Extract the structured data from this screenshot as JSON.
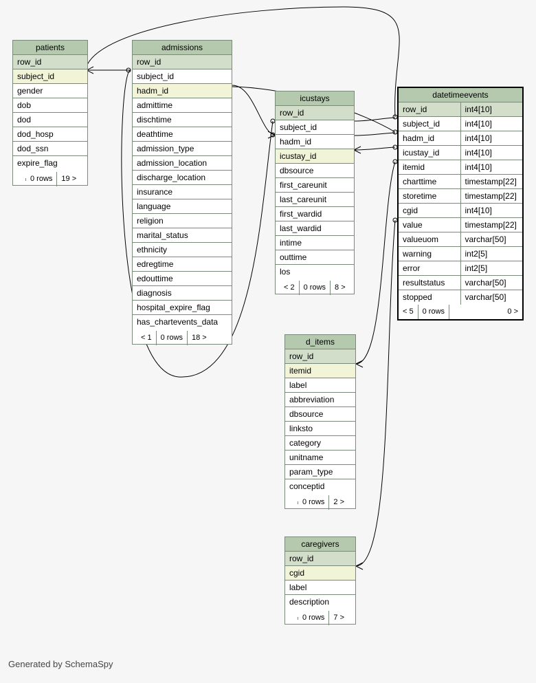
{
  "credit": "Generated by SchemaSpy",
  "tables": {
    "patients": {
      "title": "patients",
      "cols": [
        {
          "name": "row_id",
          "role": "pk"
        },
        {
          "name": "subject_id",
          "role": "fk"
        },
        {
          "name": "gender",
          "role": ""
        },
        {
          "name": "dob",
          "role": ""
        },
        {
          "name": "dod",
          "role": ""
        },
        {
          "name": "dod_hosp",
          "role": ""
        },
        {
          "name": "dod_ssn",
          "role": ""
        },
        {
          "name": "expire_flag",
          "role": ""
        }
      ],
      "footer": [
        "",
        "0 rows",
        "19 >"
      ]
    },
    "admissions": {
      "title": "admissions",
      "cols": [
        {
          "name": "row_id",
          "role": "pk"
        },
        {
          "name": "subject_id",
          "role": ""
        },
        {
          "name": "hadm_id",
          "role": "fk"
        },
        {
          "name": "admittime",
          "role": ""
        },
        {
          "name": "dischtime",
          "role": ""
        },
        {
          "name": "deathtime",
          "role": ""
        },
        {
          "name": "admission_type",
          "role": ""
        },
        {
          "name": "admission_location",
          "role": ""
        },
        {
          "name": "discharge_location",
          "role": ""
        },
        {
          "name": "insurance",
          "role": ""
        },
        {
          "name": "language",
          "role": ""
        },
        {
          "name": "religion",
          "role": ""
        },
        {
          "name": "marital_status",
          "role": ""
        },
        {
          "name": "ethnicity",
          "role": ""
        },
        {
          "name": "edregtime",
          "role": ""
        },
        {
          "name": "edouttime",
          "role": ""
        },
        {
          "name": "diagnosis",
          "role": ""
        },
        {
          "name": "hospital_expire_flag",
          "role": ""
        },
        {
          "name": "has_chartevents_data",
          "role": ""
        }
      ],
      "footer": [
        "< 1",
        "0 rows",
        "18 >"
      ]
    },
    "icustays": {
      "title": "icustays",
      "cols": [
        {
          "name": "row_id",
          "role": "pk"
        },
        {
          "name": "subject_id",
          "role": ""
        },
        {
          "name": "hadm_id",
          "role": ""
        },
        {
          "name": "icustay_id",
          "role": "fk"
        },
        {
          "name": "dbsource",
          "role": ""
        },
        {
          "name": "first_careunit",
          "role": ""
        },
        {
          "name": "last_careunit",
          "role": ""
        },
        {
          "name": "first_wardid",
          "role": ""
        },
        {
          "name": "last_wardid",
          "role": ""
        },
        {
          "name": "intime",
          "role": ""
        },
        {
          "name": "outtime",
          "role": ""
        },
        {
          "name": "los",
          "role": ""
        }
      ],
      "footer": [
        "< 2",
        "0 rows",
        "8 >"
      ]
    },
    "d_items": {
      "title": "d_items",
      "cols": [
        {
          "name": "row_id",
          "role": "pk"
        },
        {
          "name": "itemid",
          "role": "fk"
        },
        {
          "name": "label",
          "role": ""
        },
        {
          "name": "abbreviation",
          "role": ""
        },
        {
          "name": "dbsource",
          "role": ""
        },
        {
          "name": "linksto",
          "role": ""
        },
        {
          "name": "category",
          "role": ""
        },
        {
          "name": "unitname",
          "role": ""
        },
        {
          "name": "param_type",
          "role": ""
        },
        {
          "name": "conceptid",
          "role": ""
        }
      ],
      "footer": [
        "",
        "0 rows",
        "2 >"
      ]
    },
    "caregivers": {
      "title": "caregivers",
      "cols": [
        {
          "name": "row_id",
          "role": "pk"
        },
        {
          "name": "cgid",
          "role": "fk"
        },
        {
          "name": "label",
          "role": ""
        },
        {
          "name": "description",
          "role": ""
        }
      ],
      "footer": [
        "",
        "0 rows",
        "7 >"
      ]
    },
    "datetimeevents": {
      "title": "datetimeevents",
      "cols": [
        {
          "name": "row_id",
          "type": "int4[10]",
          "role": "pk"
        },
        {
          "name": "subject_id",
          "type": "int4[10]",
          "role": ""
        },
        {
          "name": "hadm_id",
          "type": "int4[10]",
          "role": ""
        },
        {
          "name": "icustay_id",
          "type": "int4[10]",
          "role": ""
        },
        {
          "name": "itemid",
          "type": "int4[10]",
          "role": ""
        },
        {
          "name": "charttime",
          "type": "timestamp[22]",
          "role": ""
        },
        {
          "name": "storetime",
          "type": "timestamp[22]",
          "role": ""
        },
        {
          "name": "cgid",
          "type": "int4[10]",
          "role": ""
        },
        {
          "name": "value",
          "type": "timestamp[22]",
          "role": ""
        },
        {
          "name": "valueuom",
          "type": "varchar[50]",
          "role": ""
        },
        {
          "name": "warning",
          "type": "int2[5]",
          "role": ""
        },
        {
          "name": "error",
          "type": "int2[5]",
          "role": ""
        },
        {
          "name": "resultstatus",
          "type": "varchar[50]",
          "role": ""
        },
        {
          "name": "stopped",
          "type": "varchar[50]",
          "role": ""
        }
      ],
      "footer": [
        "< 5",
        "0 rows",
        "0 >"
      ]
    }
  }
}
